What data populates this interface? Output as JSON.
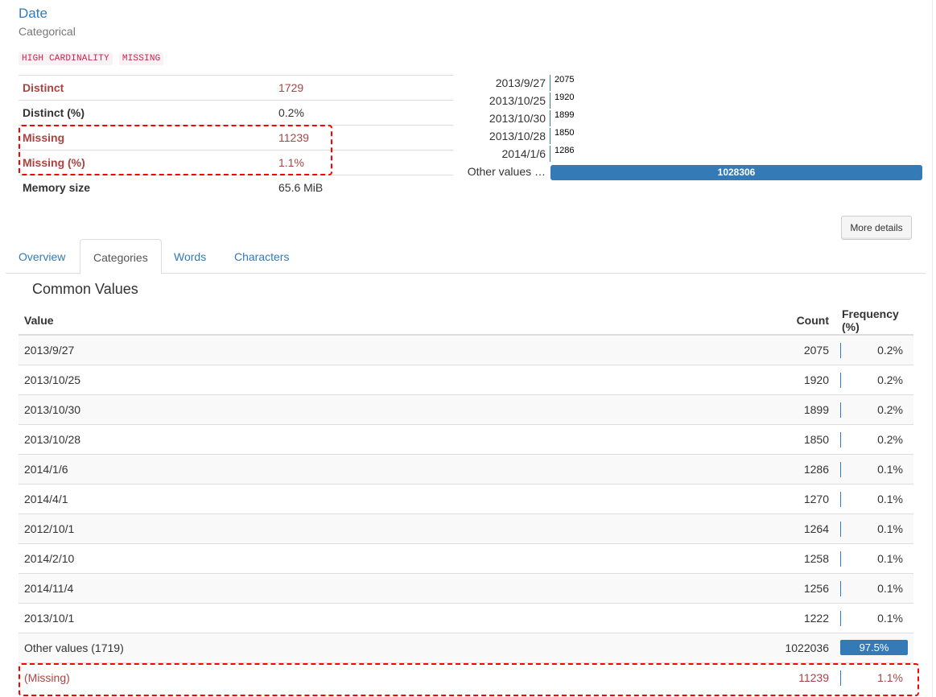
{
  "variable": {
    "name": "Date",
    "type": "Categorical"
  },
  "badges": [
    "HIGH CARDINALITY",
    "MISSING"
  ],
  "stats": [
    {
      "label": "Distinct",
      "value": "1729",
      "alert": true
    },
    {
      "label": "Distinct (%)",
      "value": "0.2%",
      "alert": false
    },
    {
      "label": "Missing",
      "value": "11239",
      "alert": true
    },
    {
      "label": "Missing (%)",
      "value": "1.1%",
      "alert": true
    },
    {
      "label": "Memory size",
      "value": "65.6 MiB",
      "alert": false
    }
  ],
  "mini_chart": {
    "rows": [
      {
        "label": "2013/9/27",
        "value": "2075"
      },
      {
        "label": "2013/10/25",
        "value": "1920"
      },
      {
        "label": "2013/10/30",
        "value": "1899"
      },
      {
        "label": "2013/10/28",
        "value": "1850"
      },
      {
        "label": "2014/1/6",
        "value": "1286"
      },
      {
        "label": "Other values …",
        "value": "1028306",
        "bar": true
      }
    ],
    "bar_color": "#337ab7"
  },
  "more_details_label": "More details",
  "tabs": [
    {
      "label": "Overview",
      "active": false
    },
    {
      "label": "Categories",
      "active": true
    },
    {
      "label": "Words",
      "active": false
    },
    {
      "label": "Characters",
      "active": false
    }
  ],
  "common_values": {
    "title": "Common Values",
    "headers": {
      "value": "Value",
      "count": "Count",
      "frequency": "Frequency (%)"
    },
    "rows": [
      {
        "value": "2013/9/27",
        "count": "2075",
        "freq": "0.2%"
      },
      {
        "value": "2013/10/25",
        "count": "1920",
        "freq": "0.2%"
      },
      {
        "value": "2013/10/30",
        "count": "1899",
        "freq": "0.2%"
      },
      {
        "value": "2013/10/28",
        "count": "1850",
        "freq": "0.2%"
      },
      {
        "value": "2014/1/6",
        "count": "1286",
        "freq": "0.1%"
      },
      {
        "value": "2014/4/1",
        "count": "1270",
        "freq": "0.1%"
      },
      {
        "value": "2012/10/1",
        "count": "1264",
        "freq": "0.1%"
      },
      {
        "value": "2014/2/10",
        "count": "1258",
        "freq": "0.1%"
      },
      {
        "value": "2014/11/4",
        "count": "1256",
        "freq": "0.1%"
      },
      {
        "value": "2013/10/1",
        "count": "1222",
        "freq": "0.1%"
      },
      {
        "value": "Other values (1719)",
        "count": "1022036",
        "freq": "97.5%",
        "bar": true
      },
      {
        "value": "(Missing)",
        "count": "11239",
        "freq": "1.1%",
        "missing": true
      }
    ]
  },
  "colors": {
    "link": "#337ab7",
    "alert": "#a94442",
    "highlight": "#ff0000",
    "badge_text": "#c7254e"
  }
}
